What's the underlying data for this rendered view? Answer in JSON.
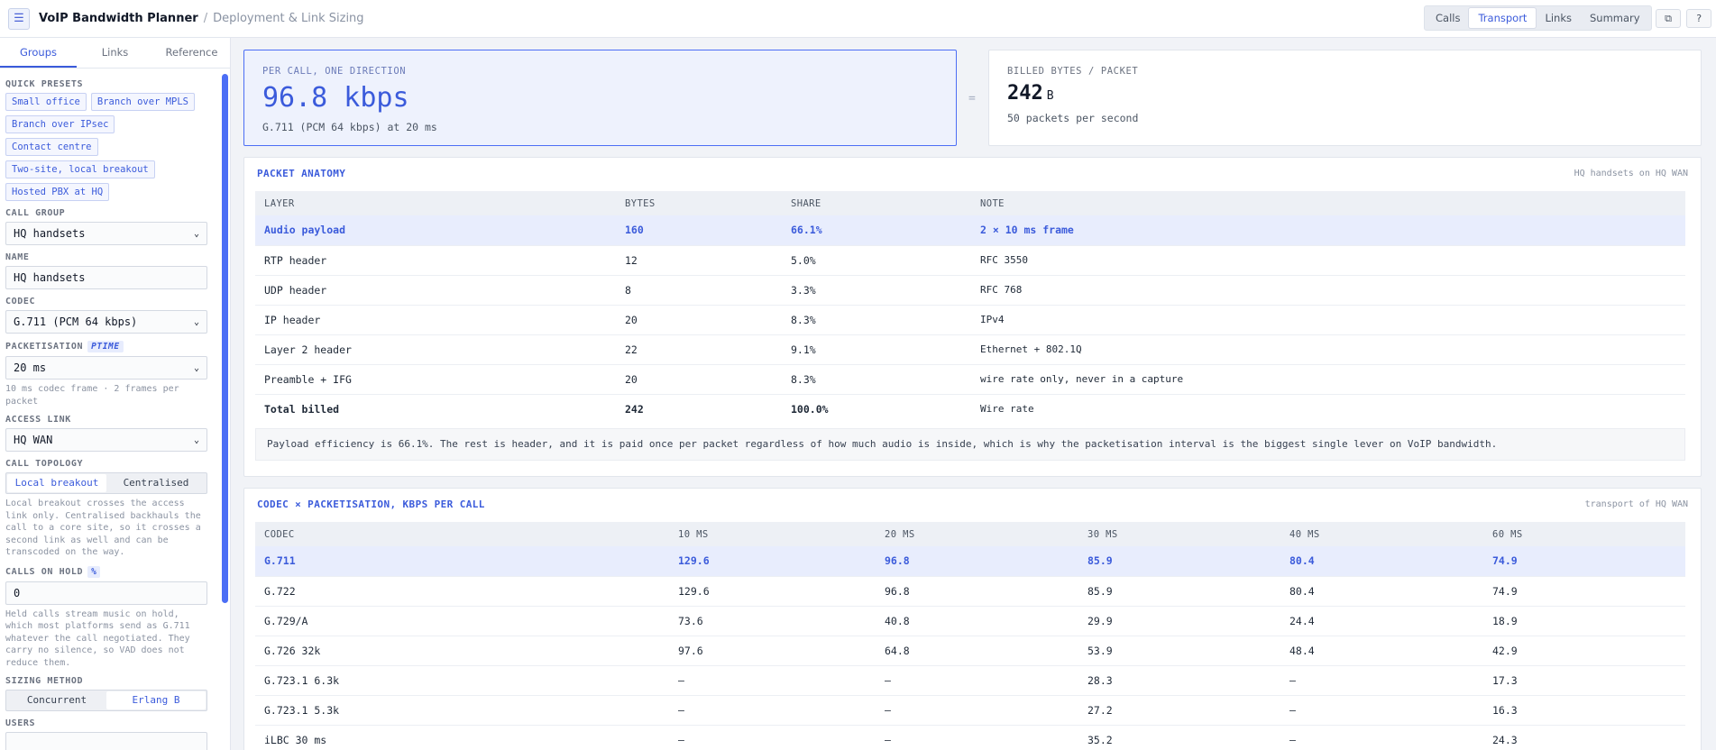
{
  "header": {
    "title": "VoIP Bandwidth Planner",
    "separator": "/",
    "subtitle": "Deployment & Link Sizing",
    "tabs": [
      "Calls",
      "Transport",
      "Links",
      "Summary"
    ],
    "active_tab": "Transport"
  },
  "sidebar": {
    "tabs": [
      "Groups",
      "Links",
      "Reference"
    ],
    "quick_presets_label": "QUICK PRESETS",
    "presets": [
      "Small office",
      "Branch over MPLS",
      "Branch over IPsec",
      "Contact centre",
      "Two-site, local breakout",
      "Hosted PBX at HQ"
    ],
    "call_group_label": "CALL GROUP",
    "call_group_value": "HQ handsets",
    "name_label": "NAME",
    "name_value": "HQ handsets",
    "codec_label": "CODEC",
    "codec_value": "G.711 (PCM 64 kbps)",
    "packetisation_label": "PACKETISATION",
    "packetisation_tag": "PTIME",
    "packetisation_value": "20 ms",
    "packetisation_hint": "10 ms codec frame · 2 frames per packet",
    "access_link_label": "ACCESS LINK",
    "access_link_value": "HQ WAN",
    "topology_label": "CALL TOPOLOGY",
    "topology_options": [
      "Local breakout",
      "Centralised"
    ],
    "topology_hint": "Local breakout crosses the access link only. Centralised backhauls the call to a core site, so it crosses a second link as well and can be transcoded on the way.",
    "hold_label": "CALLS ON HOLD",
    "hold_tag": "%",
    "hold_value": "0",
    "hold_hint": "Held calls stream music on hold, which most platforms send as G.711 whatever the call negotiated. They carry no silence, so VAD does not reduce them.",
    "sizing_label": "SIZING METHOD",
    "sizing_options": [
      "Concurrent",
      "Erlang B"
    ],
    "users_label": "USERS"
  },
  "kpi": {
    "per_call_label": "PER CALL, ONE DIRECTION",
    "per_call_value": "96.8 kbps",
    "per_call_sub": "G.711 (PCM 64 kbps) at 20 ms",
    "equals": "=",
    "billed_label": "BILLED BYTES / PACKET",
    "billed_value": "242",
    "billed_unit": "B",
    "billed_sub": "50 packets per second"
  },
  "anatomy": {
    "title": "PACKET ANATOMY",
    "note": "HQ handsets on HQ WAN",
    "columns": [
      "LAYER",
      "BYTES",
      "SHARE",
      "NOTE"
    ],
    "rows": [
      [
        "Audio payload",
        "160",
        "66.1%",
        "2 × 10 ms frame"
      ],
      [
        "RTP header",
        "12",
        "5.0%",
        "RFC 3550"
      ],
      [
        "UDP header",
        "8",
        "3.3%",
        "RFC 768"
      ],
      [
        "IP header",
        "20",
        "8.3%",
        "IPv4"
      ],
      [
        "Layer 2 header",
        "22",
        "9.1%",
        "Ethernet + 802.1Q"
      ],
      [
        "Preamble + IFG",
        "20",
        "8.3%",
        "wire rate only, never in a capture"
      ],
      [
        "Total billed",
        "242",
        "100.0%",
        "Wire rate"
      ]
    ],
    "footnote": "Payload efficiency is 66.1%. The rest is header, and it is paid once per packet regardless of how much audio is inside, which is why the packetisation interval is the biggest single lever on VoIP bandwidth."
  },
  "matrix": {
    "title": "CODEC × PACKETISATION, KBPS PER CALL",
    "note": "transport of HQ WAN",
    "columns": [
      "CODEC",
      "10 MS",
      "20 MS",
      "30 MS",
      "40 MS",
      "60 MS"
    ],
    "rows": [
      [
        "G.711",
        "129.6",
        "96.8",
        "85.9",
        "80.4",
        "74.9"
      ],
      [
        "G.722",
        "129.6",
        "96.8",
        "85.9",
        "80.4",
        "74.9"
      ],
      [
        "G.729/A",
        "73.6",
        "40.8",
        "29.9",
        "24.4",
        "18.9"
      ],
      [
        "G.726 32k",
        "97.6",
        "64.8",
        "53.9",
        "48.4",
        "42.9"
      ],
      [
        "G.723.1 6.3k",
        "—",
        "—",
        "28.3",
        "—",
        "17.3"
      ],
      [
        "G.723.1 5.3k",
        "—",
        "—",
        "27.2",
        "—",
        "16.3"
      ],
      [
        "iLBC 30 ms",
        "—",
        "—",
        "35.2",
        "—",
        "24.3"
      ]
    ]
  }
}
